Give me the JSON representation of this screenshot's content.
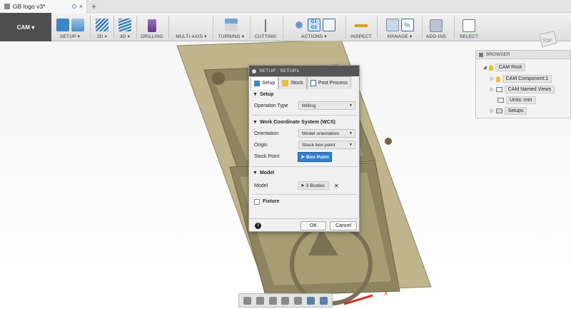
{
  "tab": {
    "title": "GB logo v3*",
    "close": "×",
    "new_tab": "+"
  },
  "workspace": {
    "label": "CAM ▾"
  },
  "toolbar": {
    "groups": [
      {
        "label": "SETUP ▾"
      },
      {
        "label": "2D ▾"
      },
      {
        "label": "3D ▾"
      },
      {
        "label": "DRILLING"
      },
      {
        "label": "MULTI-AXIS ▾"
      },
      {
        "label": "TURNING ▾"
      },
      {
        "label": "CUTTING"
      },
      {
        "label": "ACTIONS ▾"
      },
      {
        "label": "INSPECT"
      },
      {
        "label": "MANAGE ▾"
      },
      {
        "label": "ADD-INS"
      },
      {
        "label": "SELECT"
      }
    ]
  },
  "viewcube": {
    "label": "TOP"
  },
  "browser": {
    "title": "BROWSER",
    "nodes": [
      {
        "label": "CAM Root"
      },
      {
        "label": "CAM Component:1"
      },
      {
        "label": "CAM Named Views"
      },
      {
        "label": "Units: mm"
      },
      {
        "label": "Setups"
      }
    ]
  },
  "dialog": {
    "title": "SETUP : SETUP1",
    "tabs": [
      {
        "label": "Setup"
      },
      {
        "label": "Stock"
      },
      {
        "label": "Post Process"
      }
    ],
    "setup_section": "Setup",
    "operation_type_label": "Operation Type",
    "operation_type_value": "Milling",
    "wcs_section": "Work Coordinate System (WCS)",
    "orientation_label": "Orientation",
    "orientation_value": "Model orientation",
    "origin_label": "Origin",
    "origin_value": "Stock box point",
    "stock_point_label": "Stock Point",
    "stock_point_value": "Box Point",
    "model_section": "Model",
    "model_label": "Model",
    "model_value": "3 Bodies",
    "model_clear": "✕",
    "fixture_label": "Fixture",
    "fixture_checked": false,
    "ok_label": "OK",
    "cancel_label": "Cancel"
  },
  "axis": {
    "x_label": "X"
  }
}
